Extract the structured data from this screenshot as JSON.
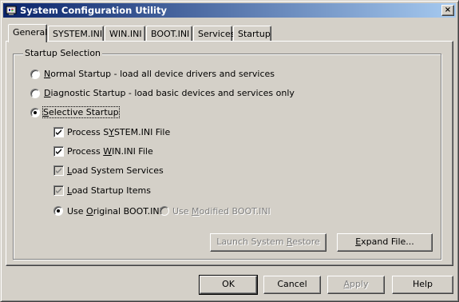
{
  "window": {
    "title": "System Configuration Utility",
    "close_glyph": "×"
  },
  "tabs": [
    {
      "label": "General",
      "active": true
    },
    {
      "label": "SYSTEM.INI"
    },
    {
      "label": "WIN.INI"
    },
    {
      "label": "BOOT.INI"
    },
    {
      "label": "Services"
    },
    {
      "label": "Startup"
    }
  ],
  "group": {
    "label": "Startup Selection"
  },
  "startup_options": {
    "normal": {
      "label_a": "N",
      "label_b": "ormal Startup - load all device drivers and services",
      "selected": false
    },
    "diagnostic": {
      "label_a": "D",
      "label_b": "iagnostic Startup - load basic devices and services only",
      "selected": false
    },
    "selective": {
      "label_a": "S",
      "label_b": "elective Startup",
      "selected": true
    }
  },
  "selective_items": {
    "system_ini": {
      "label_a": "Process S",
      "label_b": "Y",
      "label_c": "STEM.INI File",
      "checked": true,
      "enabled": true
    },
    "win_ini": {
      "label_a": "Process ",
      "label_b": "W",
      "label_c": "IN.INI File",
      "checked": true,
      "enabled": true
    },
    "services": {
      "label_a": "L",
      "label_b": "oad System Services",
      "checked": true,
      "enabled": false
    },
    "startup_items": {
      "label_a": "L",
      "label_b": "oad Startup Items",
      "checked": true,
      "enabled": false
    }
  },
  "boot_ini": {
    "original": {
      "label_a": "Use ",
      "label_b": "O",
      "label_c": "riginal BOOT.INI",
      "selected": true
    },
    "modified": {
      "label_a": "Use ",
      "label_b": "M",
      "label_c": "odified BOOT.INI",
      "selected": false,
      "enabled": false
    }
  },
  "panel_buttons": {
    "launch_restore": {
      "label_a": "Launch System ",
      "label_b": "R",
      "label_c": "estore",
      "enabled": false
    },
    "expand_file": {
      "label_a": "",
      "label_b": "E",
      "label_c": "xpand File...",
      "enabled": true
    }
  },
  "dialog_buttons": {
    "ok": "OK",
    "cancel": "Cancel",
    "apply_a": "A",
    "apply_b": "pply",
    "help": "Help"
  },
  "icons": {
    "title": "msconfig-icon",
    "check": "checkmark-icon",
    "close": "close-icon"
  }
}
